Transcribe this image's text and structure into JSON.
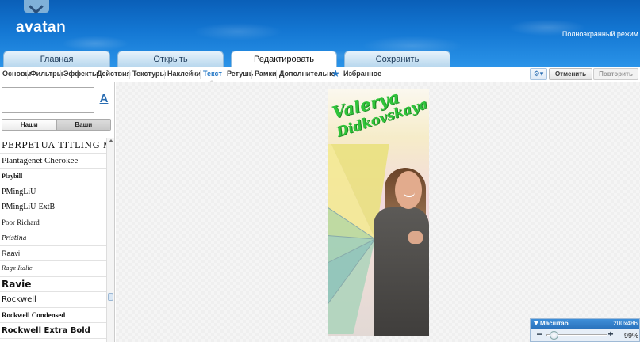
{
  "header": {
    "logo": "avatan",
    "fullscreen": "Полноэкранный режим"
  },
  "main_tabs": [
    {
      "label": "Главная"
    },
    {
      "label": "Открыть"
    },
    {
      "label": "Редактировать"
    },
    {
      "label": "Сохранить"
    }
  ],
  "toolbar": {
    "items": [
      "Основы",
      "Фильтры",
      "Эффекты",
      "Действия",
      "Текстуры",
      "Наклейки",
      "Текст",
      "Ретушь",
      "Рамки",
      "Дополнительно"
    ],
    "active": "Текст",
    "favorites": "Избранное",
    "undo": "Отменить",
    "redo": "Повторить",
    "settings_icon": "gear-icon"
  },
  "left_panel": {
    "text_input_value": "",
    "style_button": "A",
    "source_ours": "Наши",
    "source_yours": "Ваши",
    "fonts": [
      "PERPETUA TITLING MT",
      "Plantagenet Cherokee",
      "Playbill",
      "PMingLiU",
      "PMingLiU-ExtB",
      "Poor Richard",
      "Pristina",
      "Raavi",
      "Rage Italic",
      "Ravie",
      "Rockwell",
      "Rockwell Condensed",
      "Rockwell Extra Bold"
    ]
  },
  "canvas": {
    "overlay_line1": "Valerya",
    "overlay_line2": "Didkovskaya",
    "overlay_color": "#2fc43a"
  },
  "zoom": {
    "title": "Масштаб",
    "dimensions": "200x486",
    "value": "99%",
    "minus": "−",
    "plus": "+"
  }
}
